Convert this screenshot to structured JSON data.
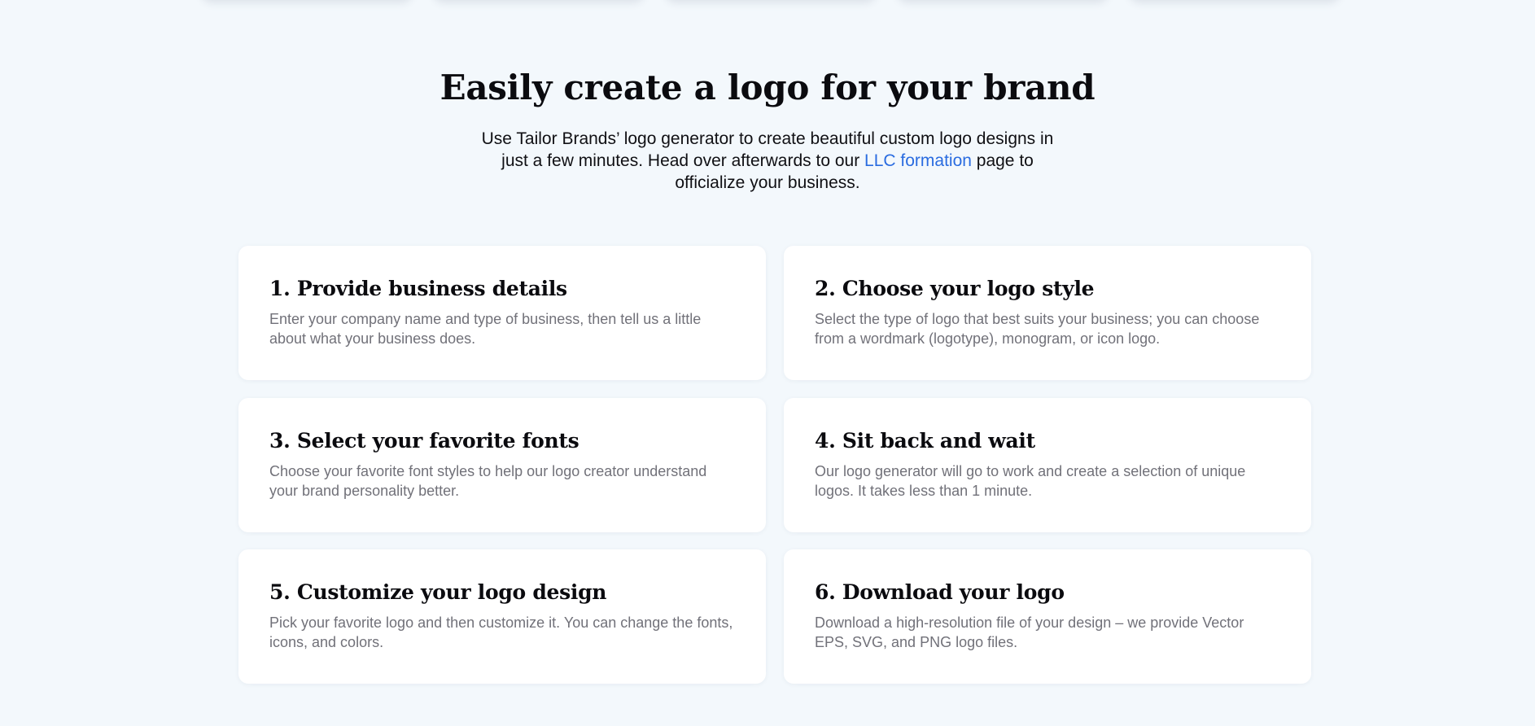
{
  "hero": {
    "title": "Easily create a logo for your brand",
    "intro_before": "Use Tailor Brands’ logo generator to create beautiful custom logo designs in just a few minutes. Head over afterwards to our ",
    "intro_link": "LLC formation",
    "intro_after": " page to officialize your business."
  },
  "steps": [
    {
      "title": "1. Provide business details",
      "text": "Enter your company name and type of business, then tell us a little about what your business does."
    },
    {
      "title": "2. Choose your logo style",
      "text": "Select the type of logo that best suits your business; you can choose from a wordmark (logotype), monogram, or icon logo."
    },
    {
      "title": "3. Select your favorite fonts",
      "text": "Choose your favorite font styles to help our logo creator understand your brand personality better."
    },
    {
      "title": "4. Sit back and wait",
      "text": "Our logo generator will go to work and create a selection of unique logos. It takes less than 1 minute."
    },
    {
      "title": "5. Customize your logo design",
      "text": "Pick your favorite logo and then customize it. You can change the fonts, icons, and colors."
    },
    {
      "title": "6. Download your logo",
      "text": "Download a high-resolution file of your design – we provide Vector EPS, SVG, and PNG logo files."
    }
  ],
  "colors": {
    "page_background": "#f3f8fc",
    "card_background": "#ffffff",
    "heading_text": "#0b0b0f",
    "body_text": "#717179",
    "link": "#2a6ce0"
  }
}
